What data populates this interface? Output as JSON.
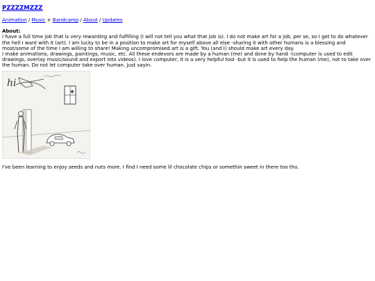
{
  "site": {
    "title": "PZZZZMZZZ"
  },
  "nav": {
    "items": [
      {
        "label": "Animation",
        "sep_after": "/"
      },
      {
        "label": "Music",
        "sep_after": "+"
      },
      {
        "label": "Bandcamp",
        "sep_after": "/"
      },
      {
        "label": "About",
        "sep_after": "/"
      },
      {
        "label": "Updates",
        "sep_after": ""
      }
    ]
  },
  "about": {
    "heading": "About:",
    "para1": "I have a full time job that is very rewarding and fulfilling (I will not tell you what that job is). I do not make art for a job, per se, so I get to do whatever the hell I want with it (art). I am lucky to be in a position to make art for myself above all else -sharing it with other humans is a blessing and most/some of the time I am willing to share! Making uncompromised art is a gift. You (and I) should make art every day.",
    "para2": "I make animations, drawings, paintings, music, etc. All these endevors are made by a human (me) and done by hand -(computer is used to edit drawings, overlay music/sound and export into videos). I love computer, it is a very helpful tool -but it is used to help the human (me), not to take over the human. Do not let computer take over human. Just sayin."
  },
  "image": {
    "handwritten_text": "hi"
  },
  "note": "I've been learning to enjoy seeds and nuts more. I find I need some lil chocolate chips or somethin sweet in there too tho."
}
